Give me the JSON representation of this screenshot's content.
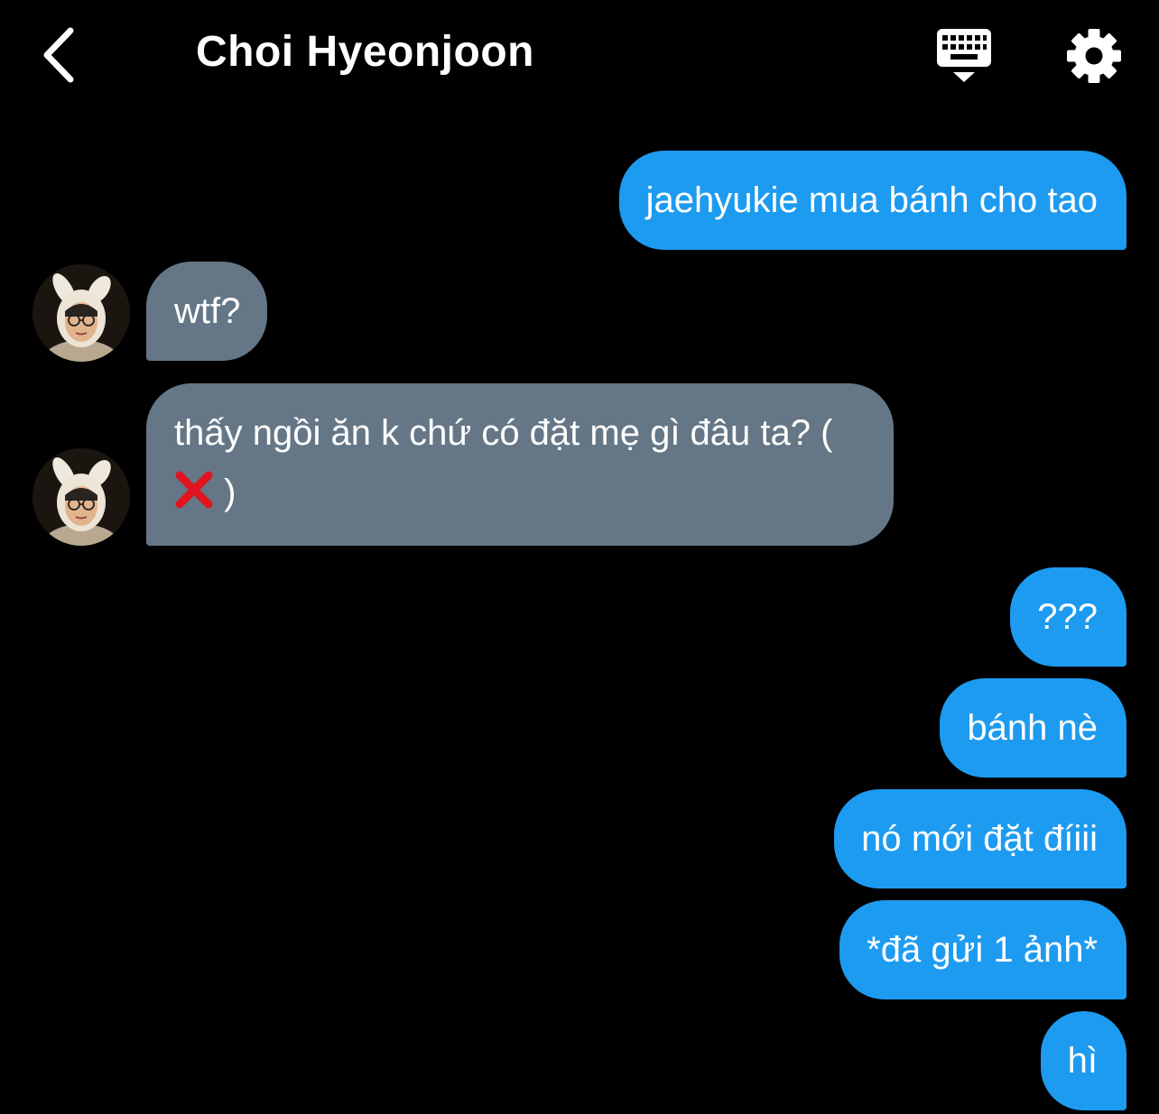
{
  "header": {
    "title": "Choi Hyeonjoon",
    "back_icon": "chevron-left-icon",
    "keyboard_icon": "keyboard-icon",
    "settings_icon": "gear-icon"
  },
  "colors": {
    "background": "#000000",
    "sent_bubble": "#1d9bf0",
    "received_bubble": "#657786",
    "text": "#ffffff",
    "x_mark": "#e0141e"
  },
  "messages": [
    {
      "side": "sent",
      "text": "jaehyukie mua bánh cho tao"
    },
    {
      "side": "received",
      "text": "wtf?"
    },
    {
      "side": "received",
      "text_before": "thấy ngồi ăn k chứ có đặt mẹ gì đâu ta? (",
      "icon": "cross-mark-icon",
      "text_after": " )"
    },
    {
      "side": "sent",
      "text": "???"
    },
    {
      "side": "sent",
      "text": "bánh nè"
    },
    {
      "side": "sent",
      "text": "nó mới đặt đíiii"
    },
    {
      "side": "sent",
      "text": "*đã gửi 1 ảnh*"
    },
    {
      "side": "sent",
      "text": "hì"
    }
  ]
}
